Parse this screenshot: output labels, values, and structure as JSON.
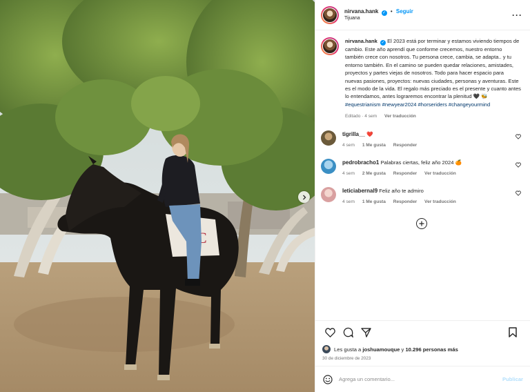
{
  "post": {
    "username": "nirvana.hank",
    "verified_glyph": "✓",
    "follow_label": "Seguir",
    "dot": "•",
    "location": "Tijuana",
    "more_icon": "more-options-icon"
  },
  "caption": {
    "username": "nirvana.hank",
    "text": "El 2023 está por terminar y estamos viviendo tiempos de cambio. Este año aprendí que conforme crecemos, nuestro entorno también crece con nosotros. Tu persona crece, cambia, se adapta.. y tu entorno también. En el camino se pueden quedar relaciones, amistades, proyectos y partes viejas de nosotros. Todo para hacer espacio para nuevas pasiones, proyectos: nuevas ciudades, personas y aventuras. Este es el modo de la vida. El regalo más preciado es el presente y cuanto antes lo entendamos, antes lograremos encontrar la plenitud 🖤 🐝",
    "hashtags": "#equestrianism #newyear2024 #horseriders #changeyourmind",
    "meta_edited": "Editado · 4 sem",
    "meta_translate": "Ver traducción"
  },
  "comments": [
    {
      "username": "tigrilla__",
      "text": "❤️",
      "age": "4 sem",
      "likes": "1 Me gusta",
      "reply": "Responder",
      "translate": "",
      "avatar_color": "#6b5a3a"
    },
    {
      "username": "pedrobracho1",
      "text": "Palabras ciertas, feliz año 2024 🍊",
      "age": "4 sem",
      "likes": "2 Me gusta",
      "reply": "Responder",
      "translate": "Ver traducción",
      "avatar_color": "#3b8fc4"
    },
    {
      "username": "leticiabernal9",
      "text": "Feliz año te admiro",
      "age": "4 sem",
      "likes": "1 Me gusta",
      "reply": "Responder",
      "translate": "Ver traducción",
      "avatar_color": "#d9a0a0"
    }
  ],
  "likes": {
    "prefix": "Les gusta a",
    "user": "joshuamouque",
    "middle": "y",
    "others": "10.296 personas más"
  },
  "date": "30 de diciembre de 2023",
  "add_comment": {
    "placeholder": "Agrega un comentario...",
    "publish": "Publicar"
  },
  "colors": {
    "link_blue": "#0095f6",
    "hashtag": "#00376b",
    "muted": "#737373",
    "publish_disabled": "#b2dffc"
  }
}
